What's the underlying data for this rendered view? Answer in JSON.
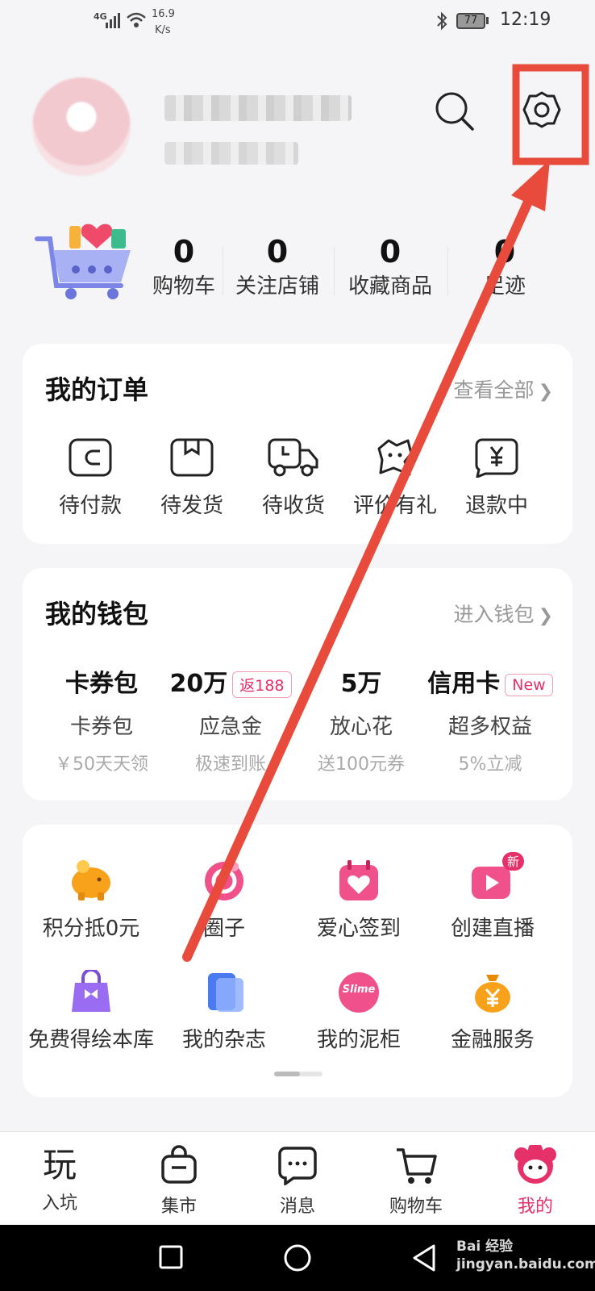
{
  "status_bar": {
    "network": "4G",
    "speed_value": "16.9",
    "speed_unit": "K/s",
    "battery": "77",
    "time": "12:19"
  },
  "stats": [
    {
      "value": "0",
      "label": "购物车"
    },
    {
      "value": "0",
      "label": "关注店铺"
    },
    {
      "value": "0",
      "label": "收藏商品"
    },
    {
      "value": "0",
      "label": "足迹"
    }
  ],
  "orders": {
    "title": "我的订单",
    "link": "查看全部",
    "items": [
      {
        "label": "待付款",
        "icon": "wallet-icon"
      },
      {
        "label": "待发货",
        "icon": "package-icon"
      },
      {
        "label": "待收货",
        "icon": "truck-icon"
      },
      {
        "label": "评价有礼",
        "icon": "review-icon"
      },
      {
        "label": "退款中",
        "icon": "refund-icon"
      }
    ]
  },
  "wallet": {
    "title": "我的钱包",
    "link": "进入钱包",
    "items": [
      {
        "big": "卡券包",
        "badge": "",
        "name": "卡券包",
        "sub": "￥50天天领"
      },
      {
        "big": "20万",
        "badge": "返188",
        "name": "应急金",
        "sub": "极速到账"
      },
      {
        "big": "5万",
        "badge": "",
        "name": "放心花",
        "sub": "送100元券"
      },
      {
        "big": "信用卡",
        "badge": "New",
        "name": "超多权益",
        "sub": "5%立减"
      }
    ]
  },
  "services": [
    {
      "label": "积分抵0元",
      "icon": "piggy-bank-icon"
    },
    {
      "label": "圈子",
      "icon": "circle-icon"
    },
    {
      "label": "爱心签到",
      "icon": "heart-calendar-icon"
    },
    {
      "label": "创建直播",
      "icon": "live-icon",
      "badge": "新"
    },
    {
      "label": "免费得绘本库",
      "icon": "gift-bag-icon"
    },
    {
      "label": "我的杂志",
      "icon": "magazine-icon"
    },
    {
      "label": "我的泥柜",
      "icon": "slime-icon",
      "icon_text": "Slime"
    },
    {
      "label": "金融服务",
      "icon": "money-bag-icon"
    }
  ],
  "tabbar": [
    {
      "label": "入坑",
      "icon": "play-icon",
      "glyph": "玩"
    },
    {
      "label": "集市",
      "icon": "shopping-bag-icon"
    },
    {
      "label": "消息",
      "icon": "message-icon"
    },
    {
      "label": "购物车",
      "icon": "cart-icon"
    },
    {
      "label": "我的",
      "icon": "profile-mascot-icon",
      "active": true
    }
  ],
  "watermark": "Bai 经验 jingyan.baidu.com",
  "colors": {
    "accent": "#e6306a",
    "annotation": "#e84b3c"
  }
}
